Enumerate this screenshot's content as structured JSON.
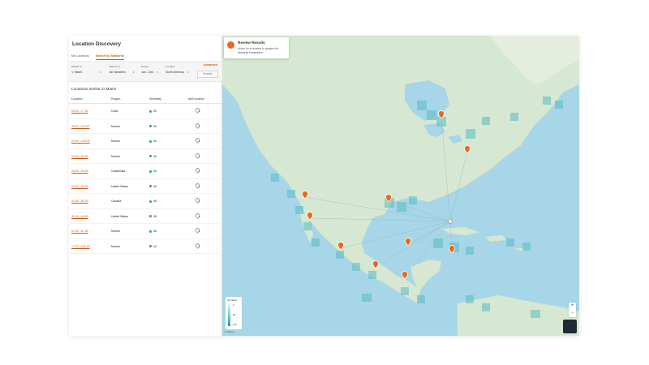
{
  "app": {
    "title": "Location Discovery"
  },
  "tabs": [
    {
      "label": "My Locations",
      "active": false
    },
    {
      "label": "Search by Similarity",
      "active": true
    }
  ],
  "filters": {
    "similar_to": {
      "label": "Similar to",
      "value": "Miami"
    },
    "based_on": {
      "label": "Based on",
      "value": "All Variables"
    },
    "during": {
      "label": "During",
      "value": "Jan - Dec"
    },
    "in_region": {
      "label": "In region",
      "value": "North America"
    },
    "advanced_label": "Advanced",
    "search_label": "Search"
  },
  "results": {
    "heading": "Locations similar to Miami",
    "columns": [
      "Location",
      "Region",
      "Similarity",
      "Add location"
    ],
    "rows": [
      {
        "location": "20.00, -77.00",
        "region": "Cuba",
        "similarity": "50"
      },
      {
        "location": "26.00, -113.00",
        "region": "Mexico",
        "similarity": "49"
      },
      {
        "location": "20.00, -103.00",
        "region": "Mexico",
        "similarity": "49"
      },
      {
        "location": "24.00, -97.00",
        "region": "Mexico",
        "similarity": "49"
      },
      {
        "location": "15.00, -90.00",
        "region": "Guatemala",
        "similarity": "49"
      },
      {
        "location": "29.00, -95.00",
        "region": "United States",
        "similarity": "49"
      },
      {
        "location": "42.00, -82.00",
        "region": "Canada",
        "similarity": "48"
      },
      {
        "location": "30.00, -94.00",
        "region": "United States",
        "similarity": "48"
      },
      {
        "location": "21.00, -87.00",
        "region": "Mexico",
        "similarity": "45"
      },
      {
        "location": "17.00, -101.00",
        "region": "Mexico",
        "similarity": "44"
      }
    ]
  },
  "map": {
    "tooltip": {
      "title": "Review Results",
      "text": "Hover on a location to analyze its similarity breakdown"
    },
    "legend": {
      "title": "Similarity",
      "labels": [
        "0",
        "50",
        "100"
      ]
    },
    "zoom": {
      "in": "+",
      "out": "−"
    },
    "attribution": "© Mapbox",
    "colors": {
      "water": "#a7d6e8",
      "land": "#d7e8d2",
      "marker": "#e8691f",
      "heat": "#58bcc4"
    }
  }
}
